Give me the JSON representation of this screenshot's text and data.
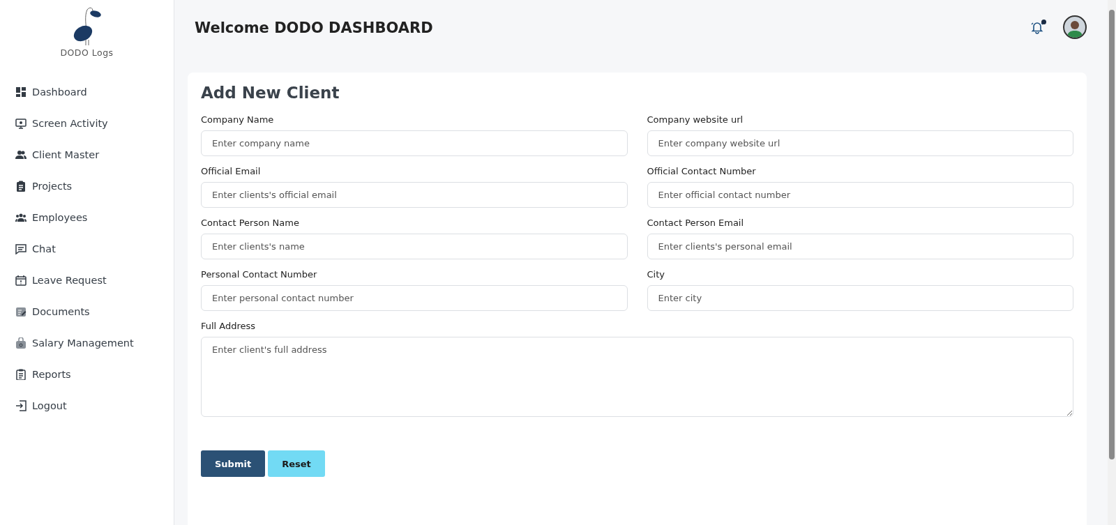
{
  "sidebar": {
    "logo_text": "DODO Logs",
    "items": [
      {
        "label": "Dashboard"
      },
      {
        "label": "Screen Activity"
      },
      {
        "label": "Client Master"
      },
      {
        "label": "Projects"
      },
      {
        "label": "Employees"
      },
      {
        "label": "Chat"
      },
      {
        "label": "Leave Request"
      },
      {
        "label": "Documents"
      },
      {
        "label": "Salary Management"
      },
      {
        "label": "Reports"
      },
      {
        "label": "Logout"
      }
    ]
  },
  "header": {
    "title": "Welcome DODO DASHBOARD",
    "notification_unread": true
  },
  "form": {
    "title": "Add New Client",
    "fields": [
      {
        "label": "Company Name",
        "placeholder": "Enter company name"
      },
      {
        "label": "Company website url",
        "placeholder": "Enter company website url"
      },
      {
        "label": "Official Email",
        "placeholder": "Enter clients's official email"
      },
      {
        "label": "Official Contact Number",
        "placeholder": "Enter official contact number"
      },
      {
        "label": "Contact Person Name",
        "placeholder": "Enter clients's name"
      },
      {
        "label": "Contact Person Email",
        "placeholder": "Enter clients's personal email"
      },
      {
        "label": "Personal Contact Number",
        "placeholder": "Enter personal contact number"
      },
      {
        "label": "City",
        "placeholder": "Enter city"
      }
    ],
    "address": {
      "label": "Full Address",
      "placeholder": "Enter client's full address"
    },
    "buttons": [
      {
        "label": "Submit",
        "kind": "primary"
      },
      {
        "label": "Reset",
        "kind": "secondary"
      }
    ]
  }
}
